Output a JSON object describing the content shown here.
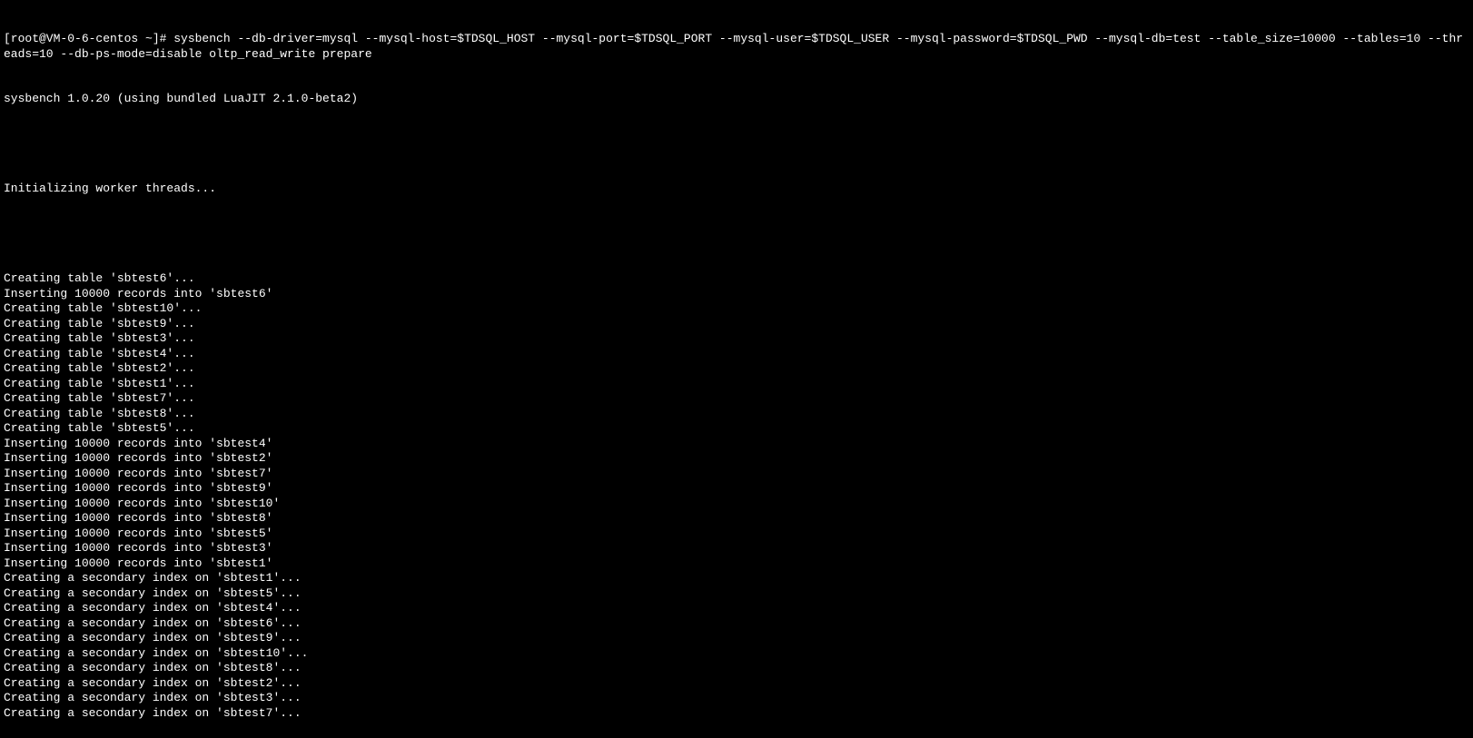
{
  "prompt_line": "[root@VM-0-6-centos ~]# sysbench --db-driver=mysql --mysql-host=$TDSQL_HOST --mysql-port=$TDSQL_PORT --mysql-user=$TDSQL_USER --mysql-password=$TDSQL_PWD --mysql-db=test --table_size=10000 --tables=10 --threads=10 --db-ps-mode=disable oltp_read_write prepare",
  "version_line": "sysbench 1.0.20 (using bundled LuaJIT 2.1.0-beta2)",
  "blank1": "",
  "init_line": "Initializing worker threads...",
  "blank2": "",
  "output_lines": [
    "Creating table 'sbtest6'...",
    "Inserting 10000 records into 'sbtest6'",
    "Creating table 'sbtest10'...",
    "Creating table 'sbtest9'...",
    "Creating table 'sbtest3'...",
    "Creating table 'sbtest4'...",
    "Creating table 'sbtest2'...",
    "Creating table 'sbtest1'...",
    "Creating table 'sbtest7'...",
    "Creating table 'sbtest8'...",
    "Creating table 'sbtest5'...",
    "Inserting 10000 records into 'sbtest4'",
    "Inserting 10000 records into 'sbtest2'",
    "Inserting 10000 records into 'sbtest7'",
    "Inserting 10000 records into 'sbtest9'",
    "Inserting 10000 records into 'sbtest10'",
    "Inserting 10000 records into 'sbtest8'",
    "Inserting 10000 records into 'sbtest5'",
    "Inserting 10000 records into 'sbtest3'",
    "Inserting 10000 records into 'sbtest1'",
    "Creating a secondary index on 'sbtest1'...",
    "Creating a secondary index on 'sbtest5'...",
    "Creating a secondary index on 'sbtest4'...",
    "Creating a secondary index on 'sbtest6'...",
    "Creating a secondary index on 'sbtest9'...",
    "Creating a secondary index on 'sbtest10'...",
    "Creating a secondary index on 'sbtest8'...",
    "Creating a secondary index on 'sbtest2'...",
    "Creating a secondary index on 'sbtest3'...",
    "Creating a secondary index on 'sbtest7'..."
  ]
}
